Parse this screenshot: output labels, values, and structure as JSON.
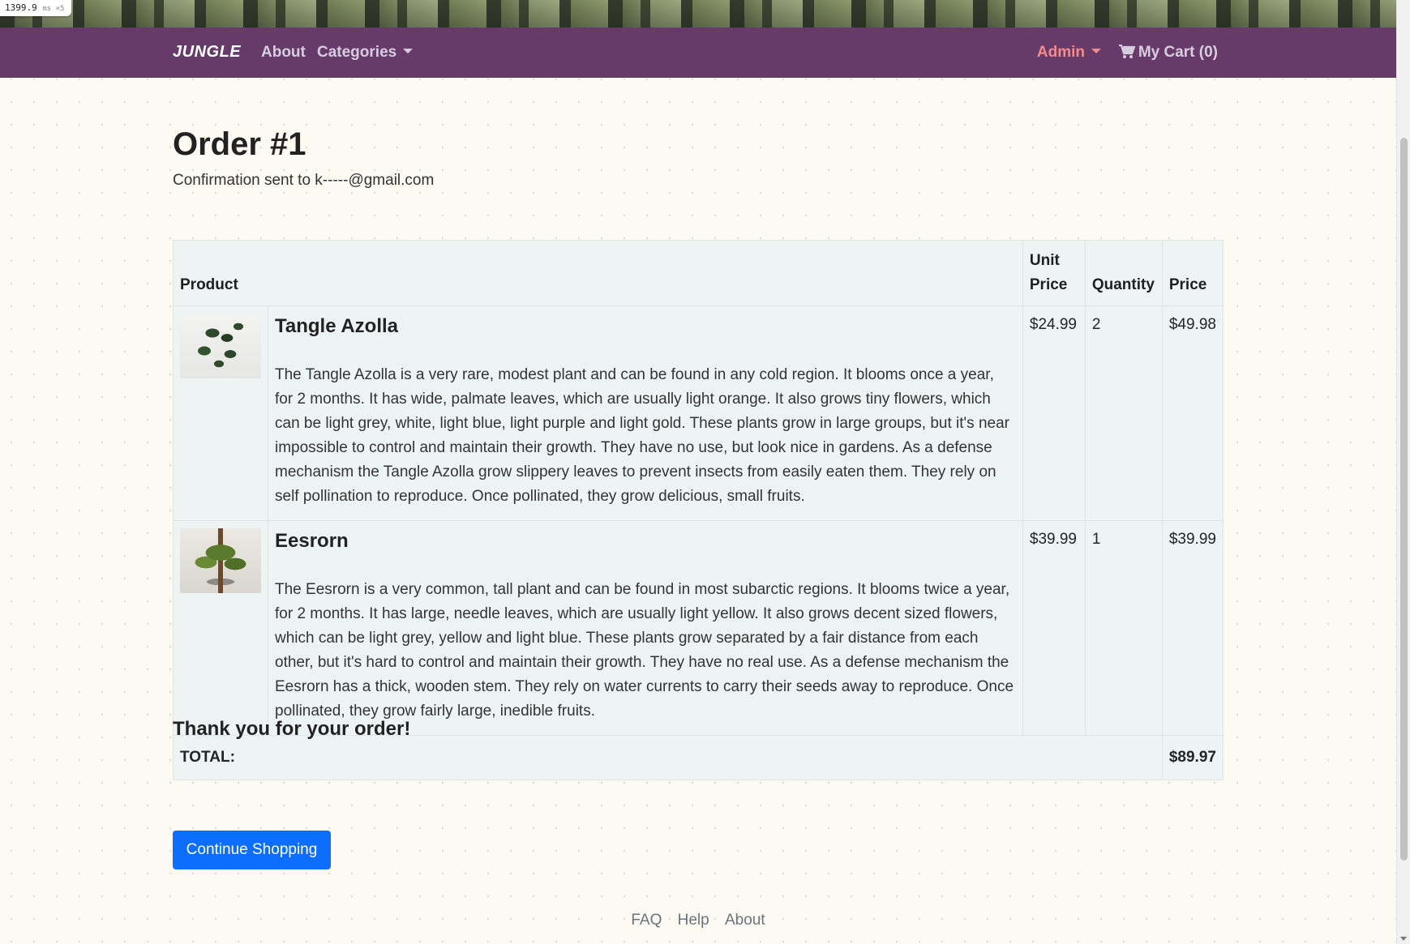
{
  "perf": {
    "value": "1399.9",
    "unit": "ms ×5"
  },
  "nav": {
    "brand": "JUNGLE",
    "about": "About",
    "categories": "Categories",
    "admin": "Admin",
    "cart": "My Cart (0)"
  },
  "order": {
    "title": "Order #1",
    "confirmation": "Confirmation sent to k-----@gmail.com",
    "columns": {
      "product": "Product",
      "unit_price": "Unit Price",
      "quantity": "Quantity",
      "price": "Price"
    },
    "items": [
      {
        "name": "Tangle Azolla",
        "description": "The Tangle Azolla is a very rare, modest plant and can be found in any cold region. It blooms once a year, for 2 months. It has wide, palmate leaves, which are usually light orange. It also grows tiny flowers, which can be light grey, white, light blue, light purple and light gold. These plants grow in large groups, but it's near impossible to control and maintain their growth. They have no use, but look nice in gardens. As a defense mechanism the Tangle Azolla grow slippery leaves to prevent insects from easily eaten them. They rely on self pollination to reproduce. Once pollinated, they grow delicious, small fruits.",
        "unit_price": "$24.99",
        "quantity": "2",
        "price": "$49.98"
      },
      {
        "name": "Eesrorn",
        "description": "The Eesrorn is a very common, tall plant and can be found in most subarctic regions. It blooms twice a year, for 2 months. It has large, needle leaves, which are usually light yellow. It also grows decent sized flowers, which can be light grey, yellow and light blue. These plants grow separated by a fair distance from each other, but it's hard to control and maintain their growth. They have no real use. As a defense mechanism the Eesrorn has a thick, wooden stem. They rely on water currents to carry their seeds away to reproduce. Once pollinated, they grow fairly large, inedible fruits.",
        "unit_price": "$39.99",
        "quantity": "1",
        "price": "$39.99"
      }
    ],
    "total_label": "TOTAL:",
    "total_value": "$89.97"
  },
  "thanks": "Thank you for your order!",
  "continue_button": "Continue Shopping",
  "footer": {
    "faq": "FAQ",
    "help": "Help",
    "about": "About"
  },
  "colors": {
    "navbar": "#673b69",
    "admin": "#f28b8b",
    "primary_button": "#0d6efd",
    "table_bg": "#eef4f3"
  }
}
